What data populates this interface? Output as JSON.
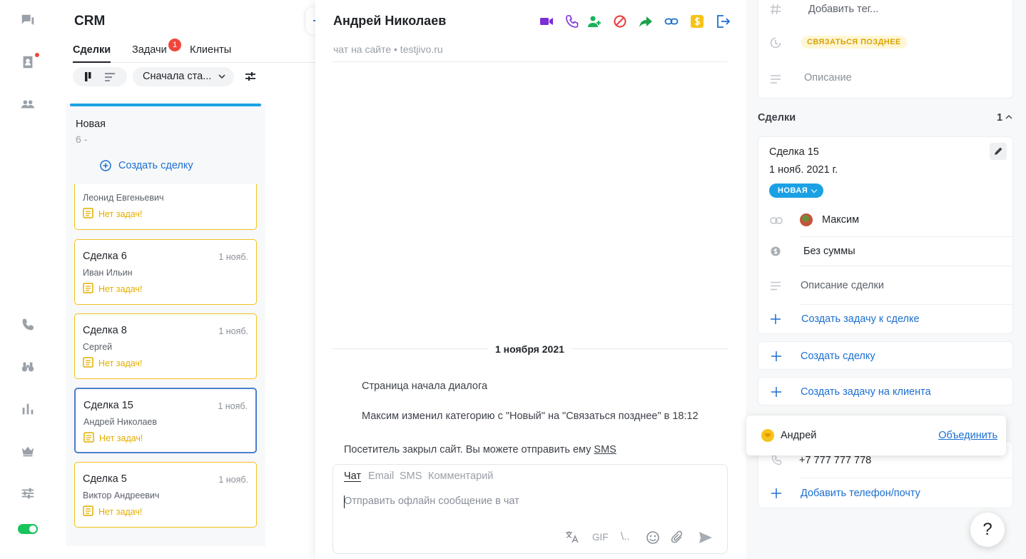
{
  "crm": {
    "title": "CRM",
    "tabs": [
      "Сделки",
      "Задачи",
      "Клиенты"
    ],
    "tasks_badge": "1",
    "sort_label": "Сначала ста...",
    "column": {
      "name": "Новая",
      "count": "6 -",
      "create_label": "Создать сделку",
      "accent_color": "#1aa1e4"
    },
    "cards": [
      {
        "title": "",
        "date": "",
        "person": "Леонид Евгеньевич",
        "task": "Нет задач!"
      },
      {
        "title": "Сделка 6",
        "date": "1 нояб.",
        "person": "Иван Ильин",
        "task": "Нет задач!"
      },
      {
        "title": "Сделка 8",
        "date": "1 нояб.",
        "person": "Сергей",
        "task": "Нет задач!"
      },
      {
        "title": "Сделка 15",
        "date": "1 нояб.",
        "person": "Андрей Николаев",
        "task": "Нет задач!"
      },
      {
        "title": "Сделка 5",
        "date": "1 нояб.",
        "person": "Виктор Андреевич",
        "task": "Нет задач!"
      }
    ]
  },
  "chat": {
    "name": "Андрей Николаев",
    "subtitle": "чат на сайте • testjivo.ru",
    "date_label": "1 ноября 2021",
    "messages": [
      "Страница начала диалога",
      "Максим изменил категорию с \"Новый\" на \"Связаться позднее\" в 18:12"
    ],
    "offline_note": "Посетитель закрыл сайт. Вы можете отправить ему",
    "offline_link": "SMS",
    "composer_tabs": [
      "Чат",
      "Email",
      "SMS",
      "Комментарий"
    ],
    "composer_placeholder": "Отправить офлайн сообщение в чат",
    "gif_label": "GIF",
    "snippet_label": "\\.."
  },
  "client": {
    "tag_placeholder": "Добавить тег...",
    "status_pill": "СВЯЗАТЬСЯ ПОЗДНЕЕ",
    "description_placeholder": "Описание",
    "deals_section_title": "Сделки",
    "deals_count": "1",
    "deal": {
      "title": "Сделка 15",
      "date": "1 нояб. 2021 г.",
      "stage": "НОВАЯ",
      "assignee": "Максим",
      "amount": "Без суммы",
      "description_placeholder": "Описание сделки",
      "create_task_label": "Создать задачу к сделке"
    },
    "create_deal_label": "Создать сделку",
    "create_client_task_label": "Создать задачу на клиента",
    "phone": "+7 777 777 778",
    "add_contact_label": "Добавить телефон/почту"
  },
  "merge_popup": {
    "name": "Андрей",
    "action": "Объединить"
  },
  "help_label": "?"
}
